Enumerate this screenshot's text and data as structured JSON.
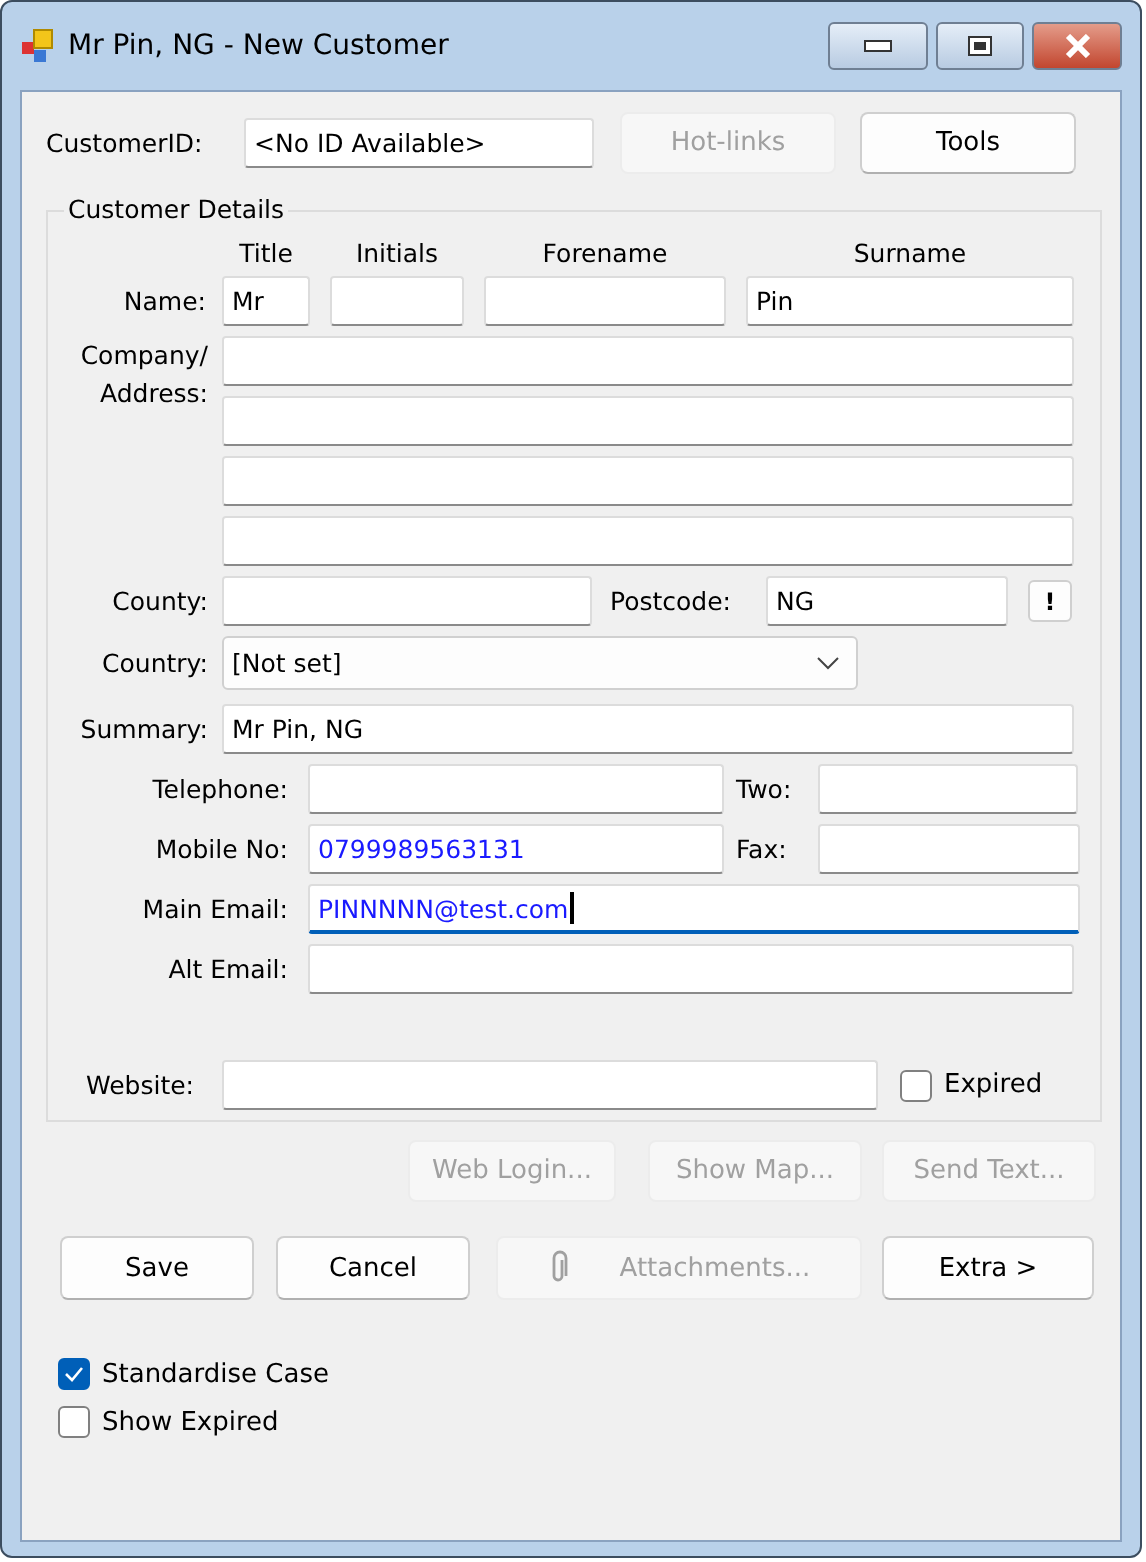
{
  "window": {
    "title": "Mr Pin, NG - New Customer"
  },
  "customer_id": {
    "label": "CustomerID:",
    "value": "<No ID Available>"
  },
  "top_buttons": [
    {
      "label": "Hot-links",
      "disabled": true
    },
    {
      "label": "Tools",
      "disabled": false
    }
  ],
  "group": {
    "title": "Customer Details",
    "name_label": "Name:",
    "name_fields": [
      {
        "header": "Title",
        "value": "Mr"
      },
      {
        "header": "Initials"
      },
      {
        "header": "Forename"
      },
      {
        "header": "Surname",
        "value": "Pin"
      }
    ],
    "address_label": [
      "Company/",
      "Address:"
    ],
    "county": {
      "label": "County:"
    },
    "postcode": {
      "label": "Postcode:",
      "value": "NG",
      "button": "!"
    },
    "country": {
      "label": "Country:",
      "value": "[Not set]"
    },
    "summary": {
      "label": "Summary:",
      "value": "Mr Pin, NG"
    },
    "contacts": [
      {
        "label": "Telephone:",
        "focused": false
      },
      {
        "label": "Two:",
        "focused": false
      },
      {
        "label": "Mobile No:",
        "value": "0799989563131",
        "focused": false
      },
      {
        "label": "Fax:",
        "focused": false
      },
      {
        "label": "Main Email:",
        "value": "PINNNNN@test.com",
        "focused": true
      },
      {
        "label": "Alt Email:",
        "focused": false
      }
    ],
    "website": {
      "label": "Website:"
    },
    "expired": {
      "label": "Expired",
      "checked": false
    }
  },
  "link_buttons": [
    {
      "label": "Web Login...",
      "disabled": true
    },
    {
      "label": "Show Map...",
      "disabled": true
    },
    {
      "label": "Send Text...",
      "disabled": true
    }
  ],
  "buttons": [
    {
      "label": "Save",
      "disabled": false
    },
    {
      "label": "Cancel",
      "disabled": false
    },
    {
      "label": "Attachments...",
      "disabled": true,
      "kind": "attach"
    },
    {
      "label": "Extra >",
      "disabled": false
    }
  ],
  "options": [
    {
      "label": "Standardise Case",
      "checked": true
    },
    {
      "label": "Show Expired",
      "checked": false
    }
  ]
}
